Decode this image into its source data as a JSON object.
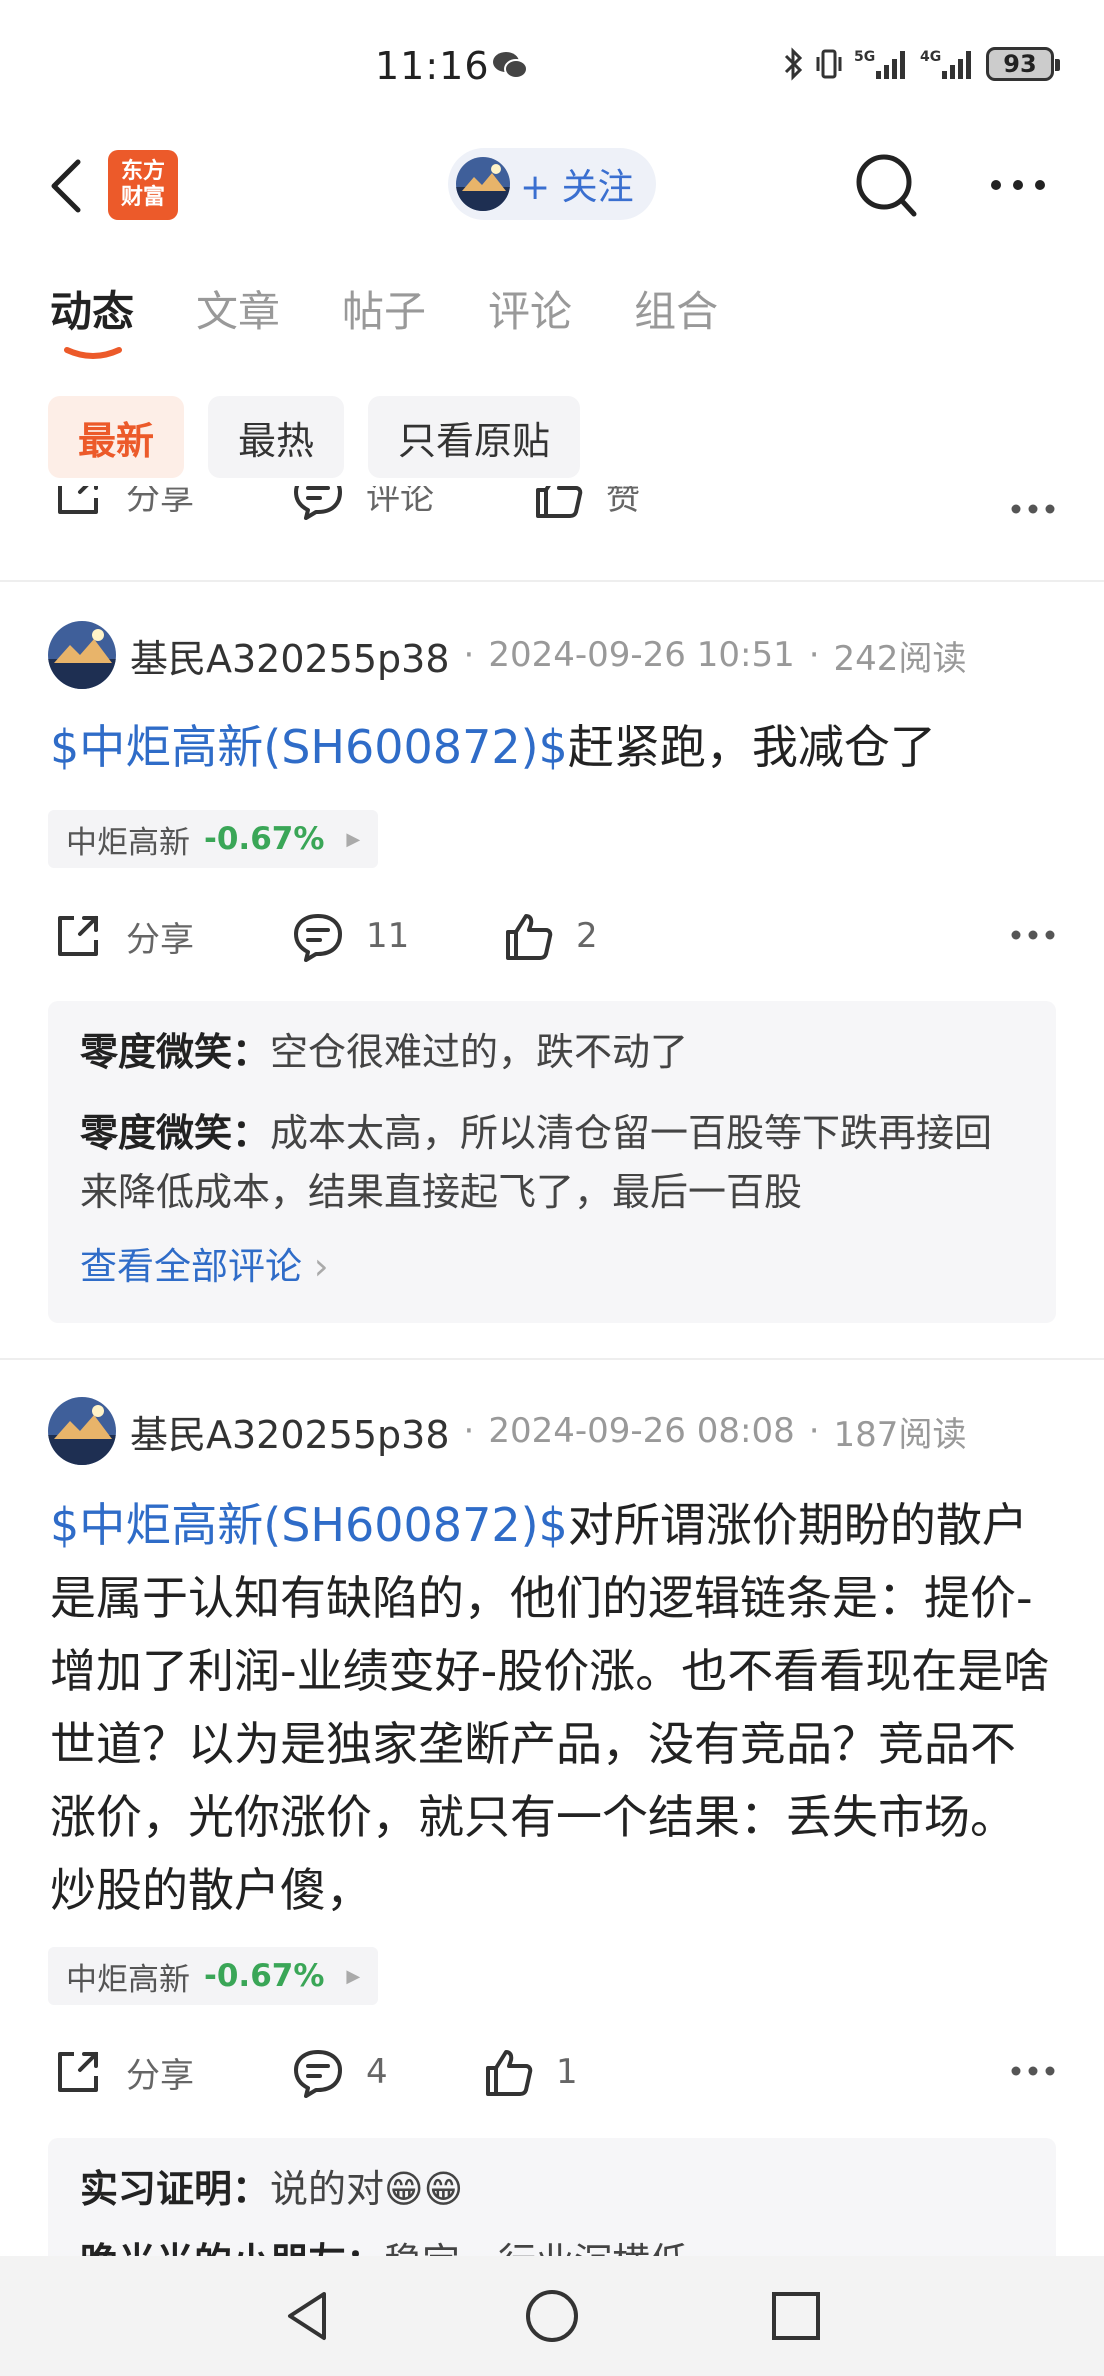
{
  "status_bar": {
    "time": "11:16",
    "battery": "93",
    "net1": "5G",
    "net2": "4G"
  },
  "header": {
    "logo_line1": "东方",
    "logo_line2": "财富",
    "follow_label": "+ 关注"
  },
  "tabs": [
    {
      "label": "动态",
      "active": true
    },
    {
      "label": "文章"
    },
    {
      "label": "帖子"
    },
    {
      "label": "评论"
    },
    {
      "label": "组合"
    }
  ],
  "filters": [
    {
      "label": "最新",
      "active": true
    },
    {
      "label": "最热"
    },
    {
      "label": "只看原贴"
    }
  ],
  "top_actions": {
    "share": "分享",
    "comment": "评论",
    "like": "赞"
  },
  "posts": [
    {
      "author": "基民A320255p38",
      "time": "2024-09-26 10:51",
      "reads": "242阅读",
      "link": "$中炬高新(SH600872)$",
      "text": "赶紧跑，我减仓了",
      "stock": {
        "name": "中炬高新",
        "change": "-0.67%"
      },
      "actions": {
        "share": "分享",
        "comments": "11",
        "likes": "2"
      },
      "comments": [
        {
          "user": "零度微笑",
          "text": "空仓很难过的，跌不动了"
        },
        {
          "user": "零度微笑",
          "text": "成本太高，所以清仓留一百股等下跌再接回来降低成本，结果直接起飞了，最后一百股"
        }
      ],
      "see_all": "查看全部评论"
    },
    {
      "author": "基民A320255p38",
      "time": "2024-09-26 08:08",
      "reads": "187阅读",
      "link": "$中炬高新(SH600872)$",
      "text": "对所谓涨价期盼的散户是属于认知有缺陷的，他们的逻辑链条是：提价-增加了利润-业绩变好-股价涨。也不看看现在是啥世道？以为是独家垄断产品，没有竞品？竞品不涨价，光你涨价，就只有一个结果：丢失市场。炒股的散户傻，",
      "stock": {
        "name": "中炬高新",
        "change": "-0.67%"
      },
      "actions": {
        "share": "分享",
        "comments": "4",
        "likes": "1"
      },
      "comments": [
        {
          "user": "实习证明",
          "text": "说的对😁😁"
        },
        {
          "user": "晚光光的小朋友",
          "text": "稳定，行业沉横低"
        }
      ]
    }
  ],
  "colors": {
    "accent": "#ec5a2a",
    "link": "#2f6cc8",
    "down_green": "#3aa657"
  }
}
